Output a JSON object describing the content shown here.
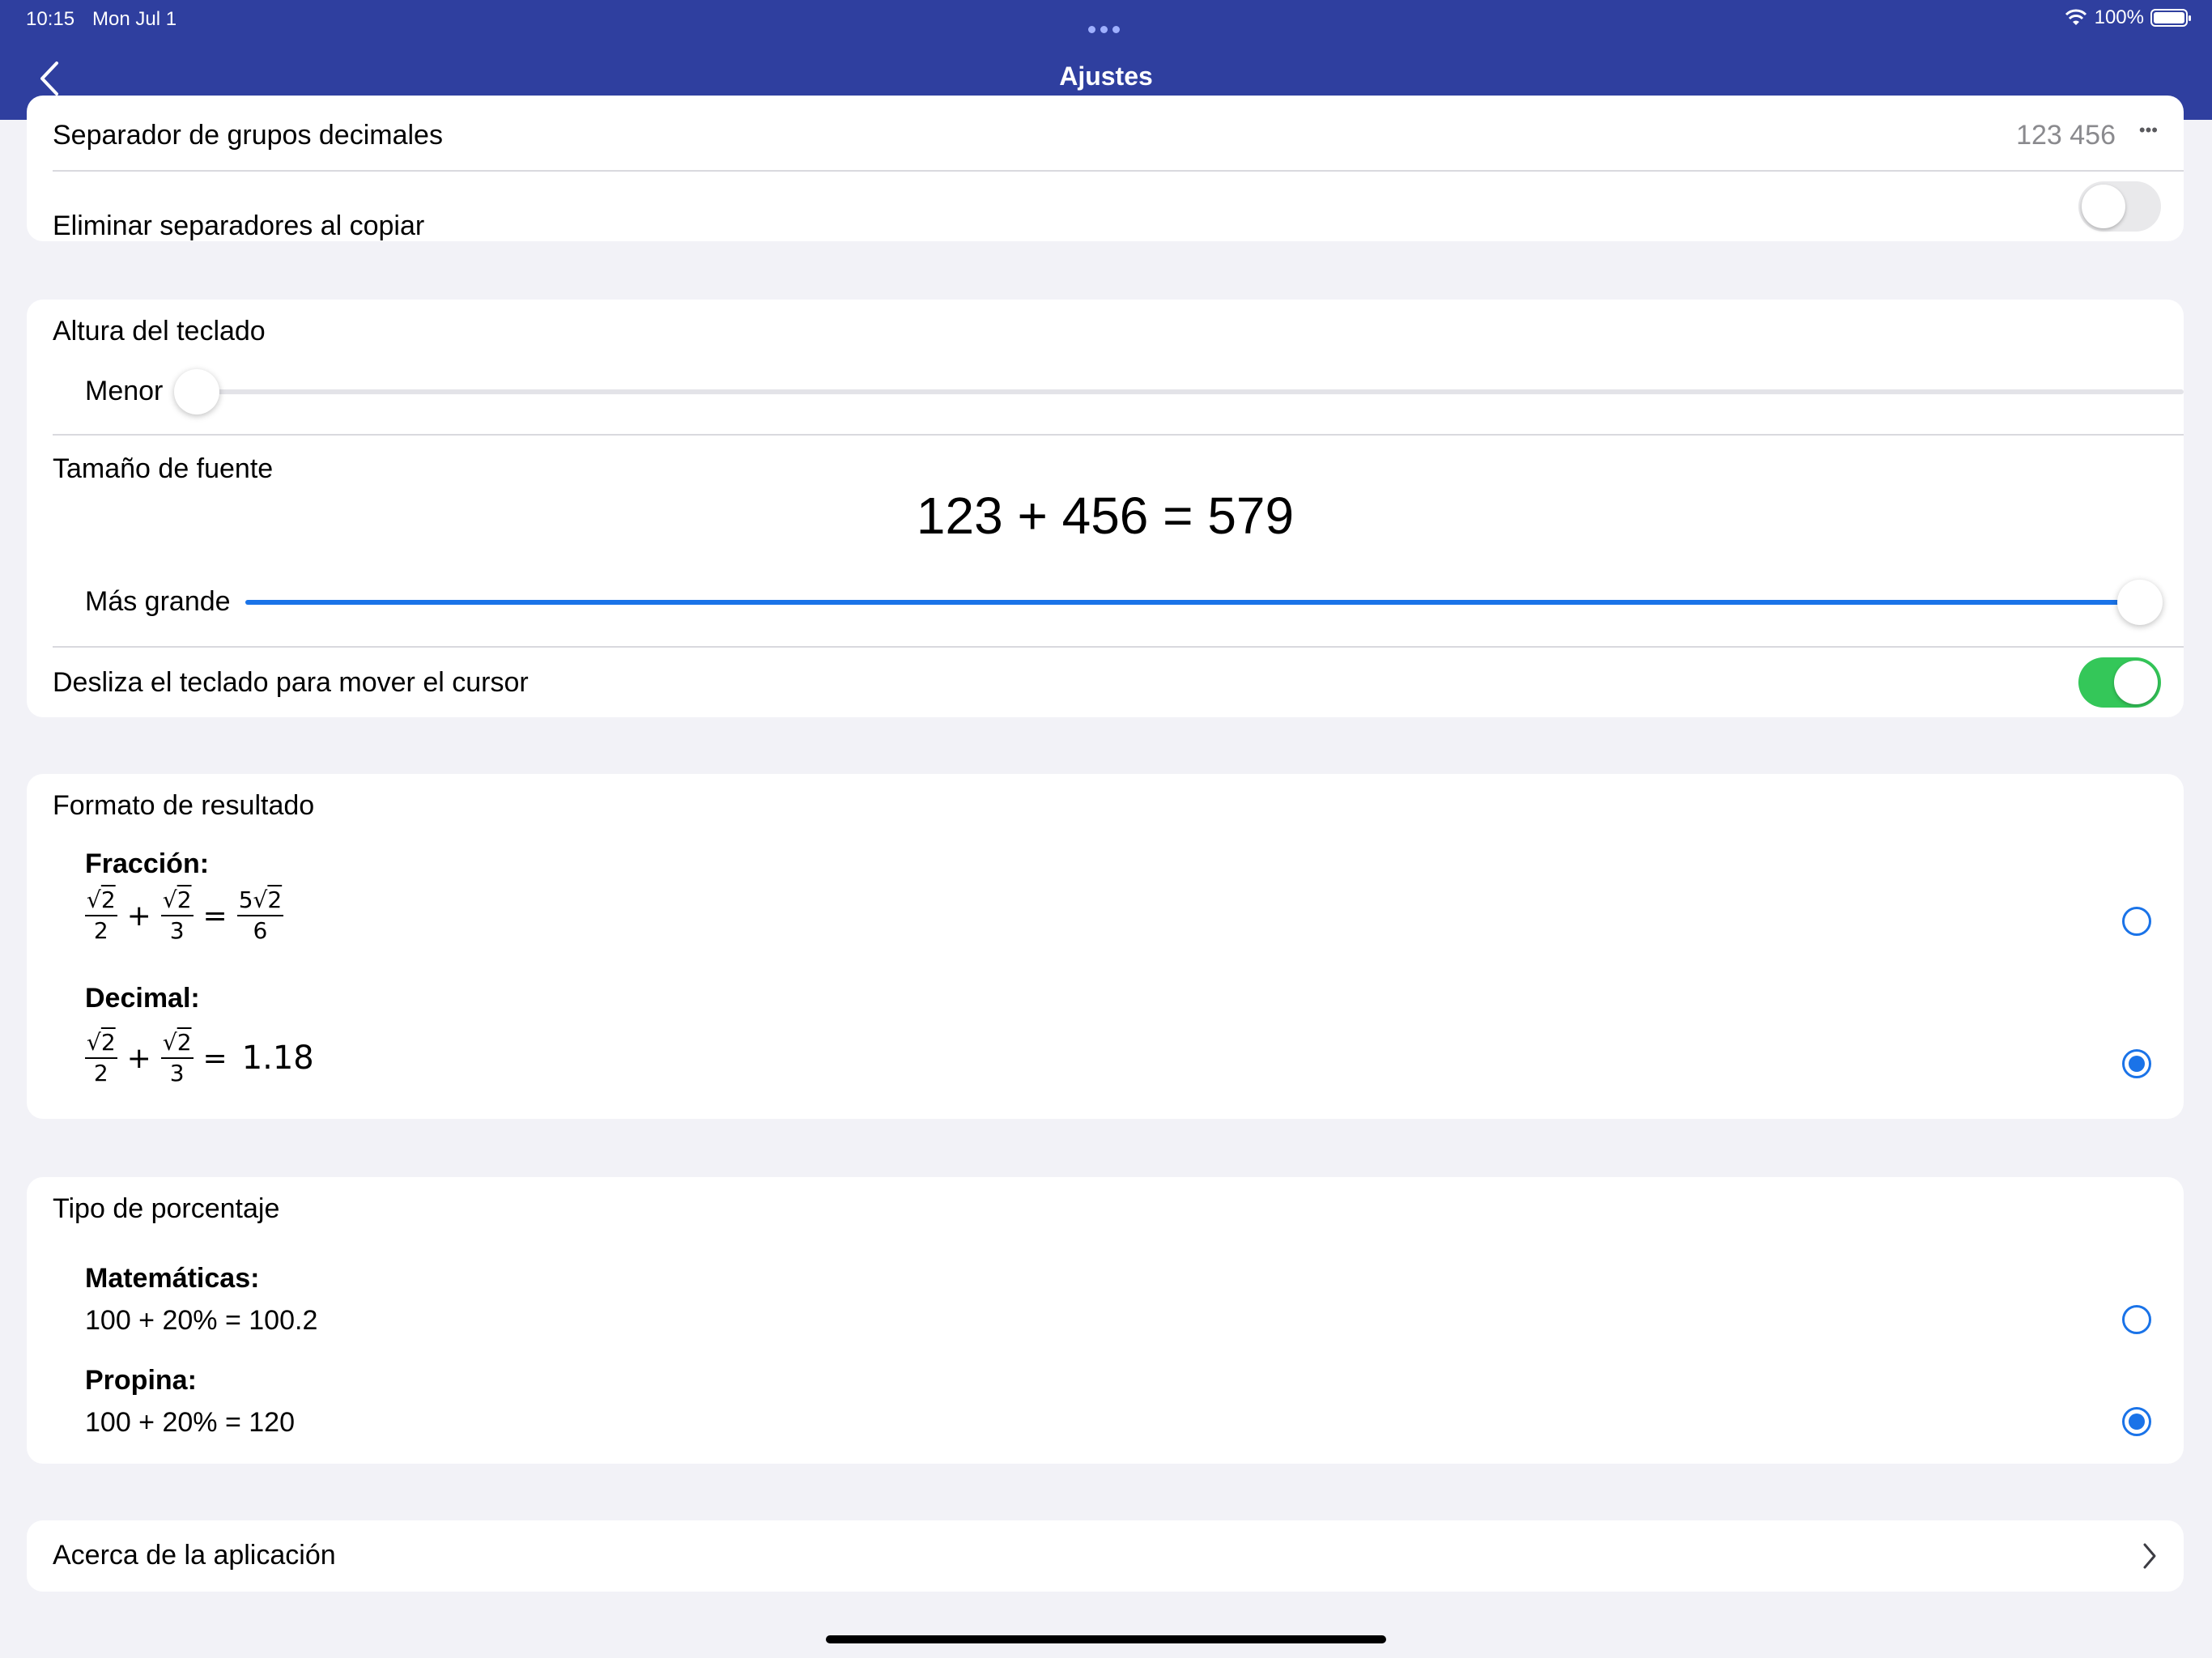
{
  "status_bar": {
    "time": "10:15",
    "date": "Mon Jul 1",
    "battery": "100%"
  },
  "nav": {
    "title": "Ajustes"
  },
  "group1": {
    "decimal_separator_label": "Separador de grupos decimales",
    "decimal_separator_value": "123 456",
    "decimal_separator_more": "•••",
    "remove_separators_label": "Eliminar separadores al copiar",
    "remove_separators_on": false
  },
  "group2": {
    "keyboard_height_label": "Altura del teclado",
    "keyboard_height_value_label": "Menor",
    "keyboard_height_level": 0.0,
    "font_size_label": "Tamaño de fuente",
    "font_size_preview": "123 + 456 = 579",
    "font_size_value_label": "Más grande",
    "font_size_level": 1.0,
    "swipe_cursor_label": "Desliza el teclado para mover el cursor",
    "swipe_cursor_on": true
  },
  "group3": {
    "title": "Formato de resultado",
    "fraction_label": "Fracción:",
    "decimal_label": "Decimal:",
    "expr": {
      "sqrt": "√",
      "radicand": "2",
      "den_a": "2",
      "den_b": "3",
      "plus": "+",
      "equals": "=",
      "frac_res_coef": "5",
      "frac_res_den": "6",
      "decimal_res": "1.18"
    },
    "selected": "decimal"
  },
  "group4": {
    "title": "Tipo de porcentaje",
    "math_label": "Matemáticas:",
    "math_example": "100 + 20% = 100.2",
    "tip_label": "Propina:",
    "tip_example": "100 + 20% = 120",
    "selected": "tip"
  },
  "group5": {
    "about_label": "Acerca de la aplicación"
  },
  "colors": {
    "nav_bar": "#2f3f9f",
    "accent": "#1a73e8",
    "toggle_on": "#34c759",
    "background": "#f2f2f7"
  },
  "icons": [
    "back-chevron-icon",
    "wifi-icon",
    "battery-icon",
    "more-icon",
    "chevron-right-icon"
  ]
}
